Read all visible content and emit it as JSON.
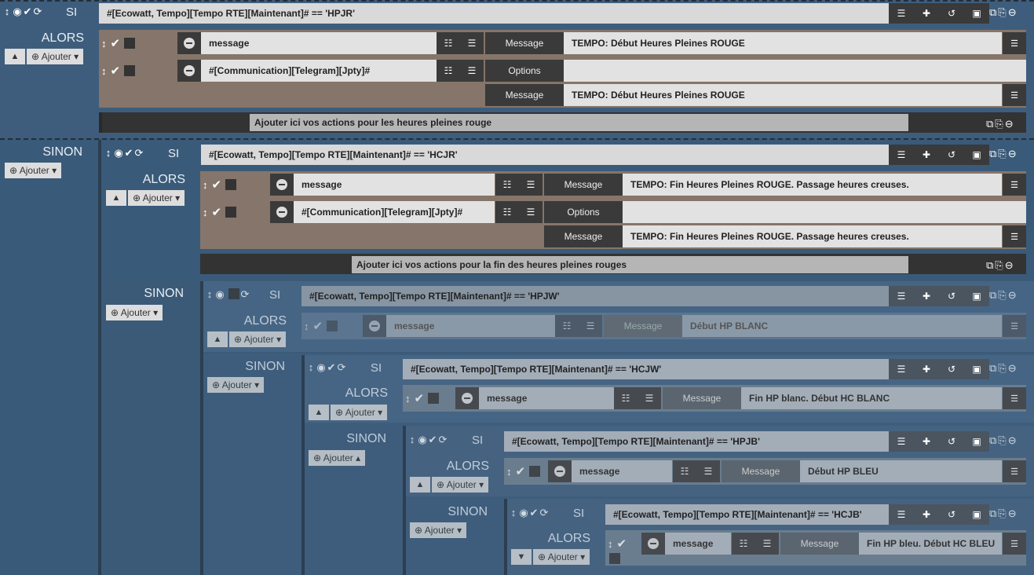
{
  "kw": {
    "si": "SI",
    "alors": "ALORS",
    "sinon": "SINON",
    "add": "Ajouter",
    "options": "Options",
    "message": "Message"
  },
  "b1": {
    "cond": "#[Ecowatt, Tempo][Tempo RTE][Maintenant]# == 'HPJR'",
    "a1": {
      "field": "message",
      "label": "Message",
      "value": "TEMPO: Début Heures Pleines ROUGE"
    },
    "a2": {
      "field": "#[Communication][Telegram][Jpty]#",
      "opt": "Options",
      "label": "Message",
      "value": "TEMPO: Début Heures Pleines ROUGE"
    },
    "hint": "Ajouter ici vos actions pour les heures pleines rouge"
  },
  "b2": {
    "cond": "#[Ecowatt, Tempo][Tempo RTE][Maintenant]# == 'HCJR'",
    "a1": {
      "field": "message",
      "label": "Message",
      "value": "TEMPO: Fin Heures Pleines ROUGE. Passage heures creuses."
    },
    "a2": {
      "field": "#[Communication][Telegram][Jpty]#",
      "opt": "Options",
      "label": "Message",
      "value": "TEMPO: Fin Heures Pleines ROUGE. Passage heures creuses."
    },
    "hint": "Ajouter ici vos actions pour la fin des heures pleines rouges"
  },
  "b3": {
    "cond": "#[Ecowatt, Tempo][Tempo RTE][Maintenant]# == 'HPJW'",
    "a1": {
      "field": "message",
      "label": "Message",
      "value": "Début HP BLANC"
    }
  },
  "b4": {
    "cond": "#[Ecowatt, Tempo][Tempo RTE][Maintenant]# == 'HCJW'",
    "a1": {
      "field": "message",
      "label": "Message",
      "value": "Fin HP blanc. Début HC BLANC"
    }
  },
  "b5": {
    "cond": "#[Ecowatt, Tempo][Tempo RTE][Maintenant]# == 'HPJB'",
    "a1": {
      "field": "message",
      "label": "Message",
      "value": "Début HP BLEU"
    }
  },
  "b6": {
    "cond": "#[Ecowatt, Tempo][Tempo RTE][Maintenant]# == 'HCJB'",
    "a1": {
      "field": "message",
      "label": "Message",
      "value": "Fin HP bleu. Début HC BLEU"
    }
  },
  "icons": [
    "move-icon",
    "eye-icon",
    "check-icon",
    "refresh-icon",
    "list-icon",
    "puzzle-icon",
    "history-icon",
    "cube-icon",
    "copy-icon",
    "paste-icon",
    "minus-circle-icon",
    "caret-down-icon",
    "caret-up-icon",
    "plus-circle-icon"
  ]
}
